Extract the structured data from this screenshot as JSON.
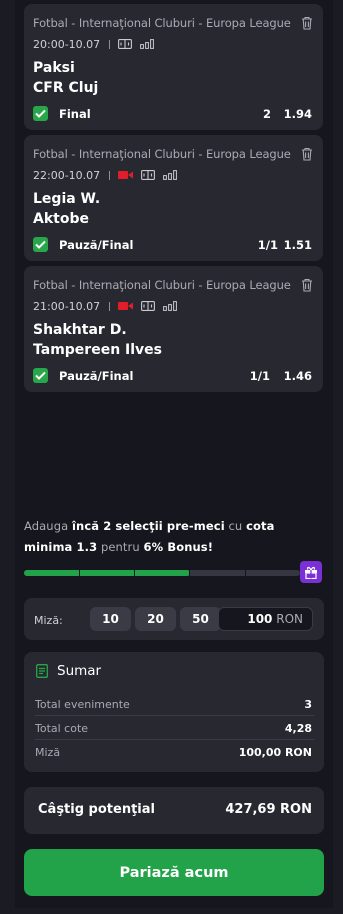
{
  "selections": [
    {
      "league": "Fotbal - Internaţional Cluburi - Europa League",
      "time": "20:00-10.07",
      "live_video": false,
      "home": "Paksi",
      "away": "CFR Cluj",
      "bet_type": "Final",
      "pick": "2",
      "odd": "1.94"
    },
    {
      "league": "Fotbal - Internaţional Cluburi - Europa League",
      "time": "22:00-10.07",
      "live_video": true,
      "home": "Legia W.",
      "away": "Aktobe",
      "bet_type": "Pauză/Final",
      "pick": "1/1",
      "odd": "1.51"
    },
    {
      "league": "Fotbal - Internaţional Cluburi - Europa League",
      "time": "21:00-10.07",
      "live_video": true,
      "home": "Shakhtar D.",
      "away": "Tampereen Ilves",
      "bet_type": "Pauză/Final",
      "pick": "1/1",
      "odd": "1.46"
    }
  ],
  "promo": {
    "t1": "Adauga ",
    "b1": "încă 2 selecţii pre-meci",
    "t2": " cu ",
    "b2": "cota minima 1.3",
    "t3": " pentru ",
    "b3": "6% Bonus!",
    "progress_fraction": 0.6
  },
  "stake": {
    "label": "Miză:",
    "chips": [
      "10",
      "20",
      "50"
    ],
    "value": "100",
    "currency": "RON"
  },
  "summary": {
    "title": "Sumar",
    "rows": [
      {
        "label": "Total evenimente",
        "value": "3"
      },
      {
        "label": "Total cote",
        "value": "4,28"
      },
      {
        "label": "Miză",
        "value": "100,00 RON"
      }
    ]
  },
  "potential": {
    "label": "Câştig potenţial",
    "value": "427,69 RON"
  },
  "cta": {
    "label": "Pariază acum"
  },
  "colors": {
    "accent_green": "#22a249",
    "bonus_purple": "#7b2fd6",
    "live_red": "#e11d2a"
  },
  "icons": [
    "trash-icon",
    "live-video-icon",
    "scoreboard-icon",
    "stats-bars-icon",
    "checkbox-checked-icon",
    "gift-icon",
    "receipt-icon"
  ]
}
